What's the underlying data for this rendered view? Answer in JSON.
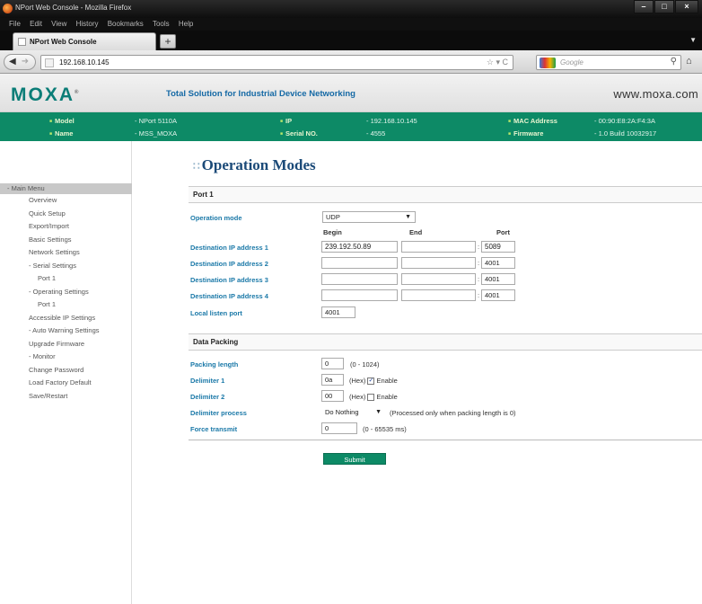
{
  "browser": {
    "window_title": "NPort Web Console - Mozilla Firefox",
    "menu": [
      "File",
      "Edit",
      "View",
      "History",
      "Bookmarks",
      "Tools",
      "Help"
    ],
    "tab_title": "NPort Web Console",
    "url": "192.168.10.145",
    "search_engine": "Google"
  },
  "header": {
    "logo": "MOXA",
    "tagline": "Total Solution for Industrial Device Networking",
    "website": "www.moxa.com"
  },
  "info": {
    "model_label": "Model",
    "model_value": "- NPort 5110A",
    "ip_label": "IP",
    "ip_value": "- 192.168.10.145",
    "mac_label": "MAC Address",
    "mac_value": "- 00:90:E8:2A:F4:3A",
    "name_label": "Name",
    "name_value": "- MSS_MOXA",
    "serial_label": "Serial NO.",
    "serial_value": "- 4555",
    "firmware_label": "Firmware",
    "firmware_value": "- 1.0 Build 10032917"
  },
  "sidebar": {
    "head": "- Main Menu",
    "items": [
      "Overview",
      "Quick Setup",
      "Export/Import",
      "Basic Settings",
      "Network Settings",
      "- Serial Settings",
      "Port 1",
      "- Operating Settings",
      "Port 1",
      "Accessible IP Settings",
      "- Auto Warning Settings",
      "Upgrade Firmware",
      "- Monitor",
      "Change Password",
      "Load Factory Default",
      "Save/Restart"
    ]
  },
  "content": {
    "title": "Operation Modes",
    "port_section": "Port 1",
    "op_mode_label": "Operation mode",
    "op_mode_value": "UDP",
    "col_begin": "Begin",
    "col_end": "End",
    "col_port": "Port",
    "dest": [
      {
        "label": "Destination IP address 1",
        "begin": "239.192.50.89",
        "end": "",
        "port": "5089"
      },
      {
        "label": "Destination IP address 2",
        "begin": "",
        "end": "",
        "port": "4001"
      },
      {
        "label": "Destination IP address 3",
        "begin": "",
        "end": "",
        "port": "4001"
      },
      {
        "label": "Destination IP address 4",
        "begin": "",
        "end": "",
        "port": "4001"
      }
    ],
    "local_port_label": "Local listen port",
    "local_port_value": "4001",
    "packing_section": "Data Packing",
    "packing_length_label": "Packing length",
    "packing_length_value": "0",
    "packing_length_hint": "(0 - 1024)",
    "delim1_label": "Delimiter 1",
    "delim1_value": "0a",
    "delim1_checked": true,
    "delim2_label": "Delimiter 2",
    "delim2_value": "00",
    "delim2_checked": false,
    "hex_text": "(Hex)",
    "enable_text": "Enable",
    "delim_process_label": "Delimiter process",
    "delim_process_value": "Do Nothing",
    "delim_process_hint": "(Processed only when packing length is 0)",
    "force_label": "Force transmit",
    "force_value": "0",
    "force_hint": "(0 - 65535 ms)",
    "submit": "Submit"
  }
}
